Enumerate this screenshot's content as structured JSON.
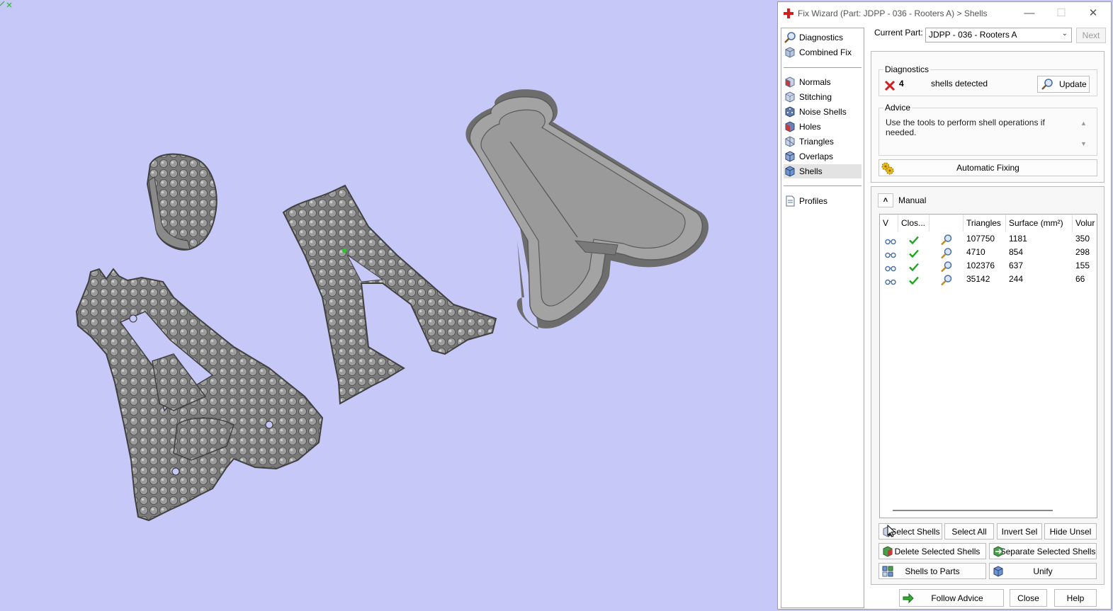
{
  "window": {
    "title": "Fix Wizard (Part: JDPP - 036 - Rooters A) > Shells",
    "minimize_icon": "minimize-icon",
    "maximize_icon": "maximize-icon",
    "close_icon": "close-icon"
  },
  "nav": {
    "top_items": [
      {
        "label": "Diagnostics",
        "icon": "magnifier-icon"
      },
      {
        "label": "Combined Fix",
        "icon": "cube-icon"
      }
    ],
    "items": [
      {
        "label": "Normals",
        "icon": "normals-cube-icon"
      },
      {
        "label": "Stitching",
        "icon": "stitching-cube-icon"
      },
      {
        "label": "Noise Shells",
        "icon": "noise-dice-icon"
      },
      {
        "label": "Holes",
        "icon": "holes-cube-icon"
      },
      {
        "label": "Triangles",
        "icon": "triangles-cube-icon"
      },
      {
        "label": "Overlaps",
        "icon": "overlaps-cube-icon"
      },
      {
        "label": "Shells",
        "icon": "shells-cube-icon",
        "selected": true
      }
    ],
    "profiles": {
      "label": "Profiles",
      "icon": "document-icon"
    }
  },
  "part": {
    "label": "Current Part:",
    "value": "JDPP - 036 - Rooters A",
    "next_label": "Next"
  },
  "diagnostics": {
    "group_label": "Diagnostics",
    "count": "4",
    "status_icon": "error-x-icon",
    "text": "shells detected",
    "update_label": "Update"
  },
  "advice": {
    "group_label": "Advice",
    "text": "Use the tools to perform shell operations if needed."
  },
  "automatic_fixing": {
    "label": "Automatic Fixing",
    "icon": "gears-icon"
  },
  "manual": {
    "label": "Manual",
    "columns": [
      "V",
      "Clos...",
      "",
      "Triangles",
      "Surface (mm²)",
      "Volur"
    ],
    "rows": [
      {
        "triangles": "107750",
        "surface": "1181",
        "volume": "350"
      },
      {
        "triangles": "4710",
        "surface": "854",
        "volume": "298"
      },
      {
        "triangles": "102376",
        "surface": "637",
        "volume": "155"
      },
      {
        "triangles": "35142",
        "surface": "244",
        "volume": "66"
      }
    ]
  },
  "buttons": {
    "select_shells": "Select Shells",
    "select_all": "Select All",
    "invert_sel": "Invert Sel",
    "hide_unsel": "Hide Unsel",
    "delete_selected": "Delete Selected Shells",
    "separate_selected": "Separate Selected Shells",
    "shells_to_parts": "Shells to Parts",
    "unify": "Unify",
    "follow_advice": "Follow Advice",
    "close": "Close",
    "help": "Help"
  },
  "colors": {
    "viewport_bg": "#c6c8f8",
    "model_gray": "#8c8c8c",
    "error_red": "#d21e1e",
    "ok_green": "#1fa51f"
  }
}
